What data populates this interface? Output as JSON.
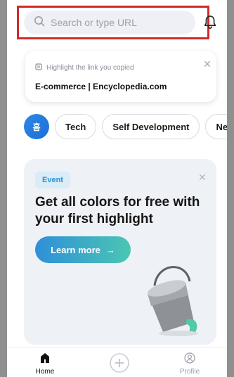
{
  "search": {
    "placeholder": "Search or type URL"
  },
  "clip_card": {
    "hint": "Highlight the link you copied",
    "link_title": "E-commerce | Encyclopedia.com"
  },
  "categories": [
    "홈",
    "Tech",
    "Self Development",
    "Ne"
  ],
  "event_card": {
    "badge": "Event",
    "title": "Get all colors for free with your first highlight",
    "cta": "Learn more",
    "cta_arrow": "→"
  },
  "bottom_nav": {
    "home": "Home",
    "profile": "Profile"
  },
  "colors": {
    "accent": "#1a6fd6",
    "cta_start": "#2f8fd8",
    "cta_end": "#4bc6b3",
    "highlight_border": "#d12a2a"
  },
  "icons": {
    "search": "search-icon",
    "bell": "bell-icon",
    "clipboard": "clipboard-icon",
    "close": "close-icon",
    "add": "plus-circle-icon",
    "profile": "profile-icon",
    "home": "home-icon"
  }
}
